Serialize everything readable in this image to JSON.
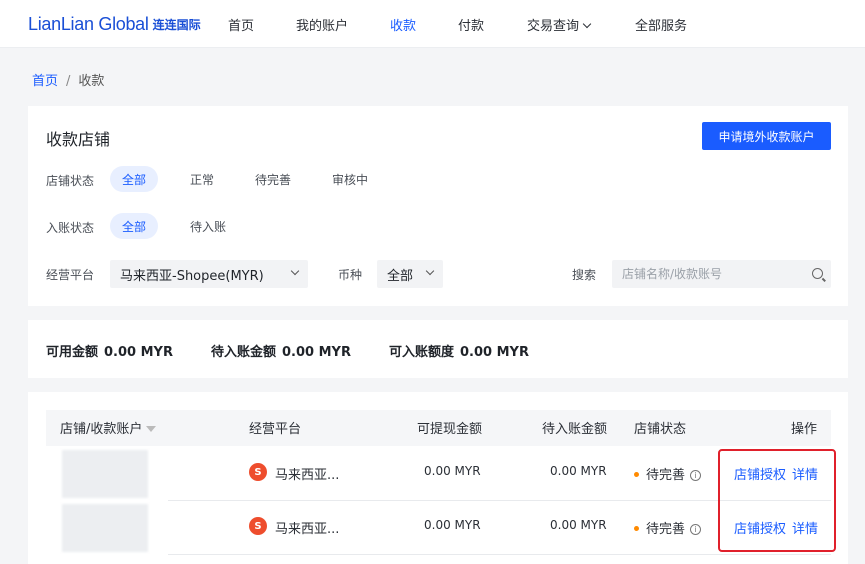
{
  "brand": {
    "logo_en": "LianLian Global",
    "logo_cn": "连连国际"
  },
  "nav": {
    "items": [
      "首页",
      "我的账户",
      "收款",
      "付款",
      "交易查询",
      "全部服务"
    ],
    "active_index": 2
  },
  "breadcrumb": {
    "home": "首页",
    "separator": "/",
    "current": "收款"
  },
  "filters": {
    "title": "收款店铺",
    "apply_button": "申请境外收款账户",
    "store_status": {
      "label": "店铺状态",
      "options": [
        "全部",
        "正常",
        "待完善",
        "审核中"
      ],
      "selected": "全部"
    },
    "entry_status": {
      "label": "入账状态",
      "options": [
        "全部",
        "待入账"
      ],
      "selected": "全部"
    },
    "platform": {
      "label": "经营平台",
      "value": "马来西亚-Shopee(MYR)"
    },
    "currency": {
      "label": "币种",
      "value": "全部"
    },
    "search": {
      "label": "搜索",
      "placeholder": "店铺名称/收款账号",
      "value": ""
    }
  },
  "summary": {
    "available": {
      "label": "可用金额",
      "value": "0.00 MYR"
    },
    "pending": {
      "label": "待入账金额",
      "value": "0.00 MYR"
    },
    "credit": {
      "label": "可入账额度",
      "value": "0.00 MYR"
    }
  },
  "table": {
    "columns": [
      "店铺/收款账户",
      "经营平台",
      "可提现金额",
      "待入账金额",
      "店铺状态",
      "操作"
    ],
    "rows": [
      {
        "platform_icon": "S",
        "platform": "马来西亚...",
        "withdrawable": "0.00 MYR",
        "pending": "0.00 MYR",
        "status": "待完善",
        "actions": [
          "店铺授权",
          "详情"
        ]
      },
      {
        "platform_icon": "S",
        "platform": "马来西亚...",
        "withdrawable": "0.00 MYR",
        "pending": "0.00 MYR",
        "status": "待完善",
        "actions": [
          "店铺授权",
          "详情"
        ]
      }
    ]
  },
  "colors": {
    "primary": "#1a5cff",
    "highlight": "#e0202b",
    "status_pending": "#ff8a00",
    "shopee": "#ee4d2d"
  }
}
